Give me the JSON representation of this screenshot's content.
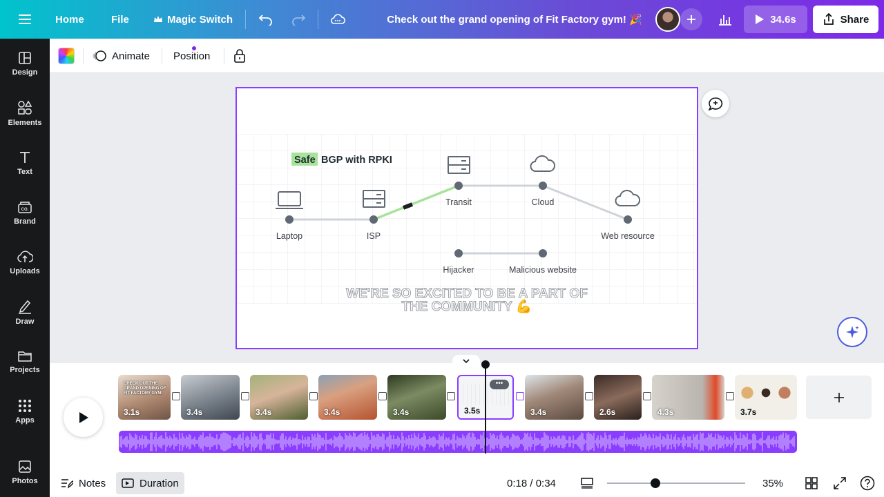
{
  "topbar": {
    "home_label": "Home",
    "file_label": "File",
    "magic_switch_label": "Magic Switch",
    "design_title": "Check out the grand opening of Fit Factory gym! 🎉",
    "play_duration": "34.6s",
    "share_label": "Share"
  },
  "sidebar": {
    "items": [
      {
        "label": "Design",
        "icon": "design-icon"
      },
      {
        "label": "Elements",
        "icon": "elements-icon"
      },
      {
        "label": "Text",
        "icon": "text-icon"
      },
      {
        "label": "Brand",
        "icon": "brand-icon"
      },
      {
        "label": "Uploads",
        "icon": "uploads-icon"
      },
      {
        "label": "Draw",
        "icon": "draw-icon"
      },
      {
        "label": "Projects",
        "icon": "projects-icon"
      },
      {
        "label": "Apps",
        "icon": "apps-icon"
      },
      {
        "label": "Photos",
        "icon": "photos-icon"
      }
    ]
  },
  "toolbar": {
    "animate_label": "Animate",
    "position_label": "Position"
  },
  "slide": {
    "heading_highlight": "Safe",
    "heading_rest": "BGP with RPKI",
    "nodes": {
      "laptop": "Laptop",
      "isp": "ISP",
      "transit": "Transit",
      "cloud": "Cloud",
      "web_resource": "Web resource",
      "hijacker": "Hijacker",
      "malicious_website": "Malicious website"
    },
    "caption_line1": "WE'RE SO EXCITED TO BE A PART OF",
    "caption_line2": "THE COMMUNITY 💪"
  },
  "timeline": {
    "clips": [
      {
        "duration": "3.1s",
        "overlay": "CHECK OUT THE GRAND OPENING OF FIT FACTORY GYM!",
        "color": "#c9b7a6"
      },
      {
        "duration": "3.4s",
        "overlay": "",
        "color": "#8b8f95"
      },
      {
        "duration": "3.4s",
        "overlay": "",
        "color": "#7a8a5a"
      },
      {
        "duration": "3.4s",
        "overlay": "",
        "color": "#b5532f"
      },
      {
        "duration": "3.4s",
        "overlay": "",
        "color": "#5d6a3f"
      },
      {
        "duration": "3.5s",
        "overlay": "",
        "color": "#f4f5f7"
      },
      {
        "duration": "3.4s",
        "overlay": "",
        "color": "#9e8c7d"
      },
      {
        "duration": "2.6s",
        "overlay": "",
        "color": "#6c5448"
      },
      {
        "duration": "4.3s",
        "overlay": "",
        "color": "#c7c3bd"
      },
      {
        "duration": "3.7s",
        "overlay": "",
        "color": "#e6e2d8"
      }
    ]
  },
  "bottom": {
    "notes_label": "Notes",
    "duration_label": "Duration",
    "time_display": "0:18 / 0:34",
    "zoom_label": "35%",
    "zoom_fraction": 0.35
  },
  "colors": {
    "accent": "#8b3dff",
    "safe_green": "#a7e39a",
    "node_gray": "#5f6873"
  }
}
